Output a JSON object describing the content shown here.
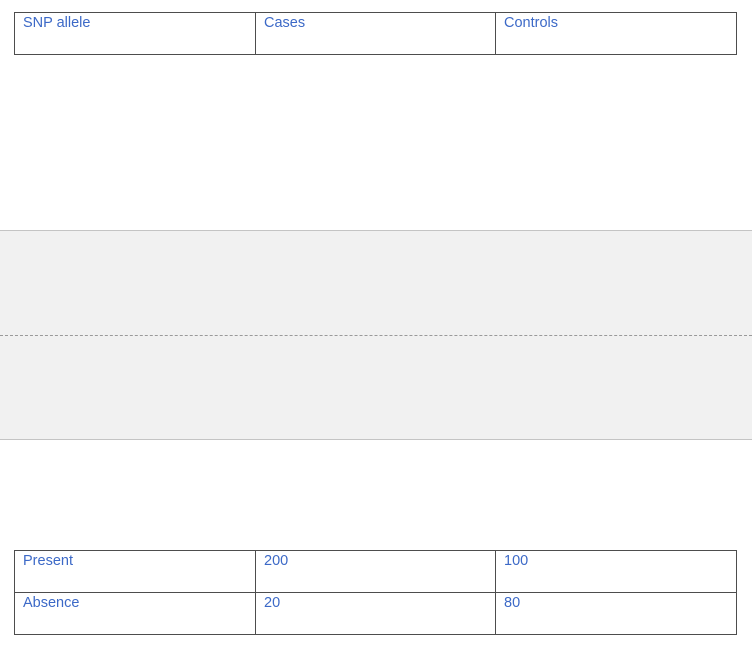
{
  "header_table": {
    "columns": [
      "SNP allele",
      "Cases",
      "Controls"
    ]
  },
  "body_table": {
    "rows": [
      [
        "Present",
        "200",
        "100"
      ],
      [
        "Absence",
        "20",
        "80"
      ]
    ]
  },
  "colors": {
    "text": "#3c69c7",
    "border": "#4d4d4d",
    "page_gap": "#f1f1f1"
  }
}
